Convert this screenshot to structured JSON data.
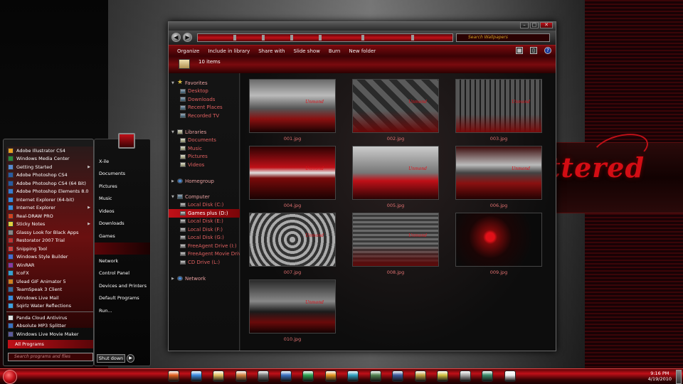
{
  "explorer": {
    "search_placeholder": "Search Wallpapers",
    "toolbar": [
      "Organize",
      "Include in library",
      "Share with",
      "Slide show",
      "Burn",
      "New folder"
    ],
    "item_count": "10 items",
    "nav": {
      "favorites": {
        "label": "Favorites",
        "items": [
          "Desktop",
          "Downloads",
          "Recent Places",
          "Recorded TV"
        ]
      },
      "libraries": {
        "label": "Libraries",
        "items": [
          "Documents",
          "Music",
          "Pictures",
          "Videos"
        ]
      },
      "homegroup": "Homegroup",
      "computer": {
        "label": "Computer",
        "items": [
          "Local Disk (C:)",
          "Games plus (D:)",
          "Local Disk (E:)",
          "Local Disk (F:)",
          "Local Disk (G:)",
          "FreeAgent Drive (I:)",
          "FreeAgent Movie Drive (",
          "CD Drive (L:)"
        ],
        "selected_index": 1
      },
      "network": "Network"
    },
    "files": [
      "001.jpg",
      "002.jpg",
      "003.jpg",
      "004.jpg",
      "005.jpg",
      "006.jpg",
      "007.jpg",
      "008.jpg",
      "009.jpg",
      "010.jpg"
    ],
    "watermark": "Unmond"
  },
  "start_menu": {
    "programs": [
      {
        "label": "Adobe Illustrator CS4",
        "color": "#e8a020"
      },
      {
        "label": "Windows Media Center",
        "color": "#2a8a3a"
      },
      {
        "label": "Getting Started",
        "color": "#5a8ad0",
        "submenu": true
      },
      {
        "label": "Adobe Photoshop CS4",
        "color": "#2a5aa0"
      },
      {
        "label": "Adobe Photoshop CS4 (64 Bit)",
        "color": "#2a5aa0"
      },
      {
        "label": "Adobe Photoshop Elements 8.0",
        "color": "#3a7ad0"
      },
      {
        "label": "Internet Explorer (64-bit)",
        "color": "#3a8ae0"
      },
      {
        "label": "Internet Explorer",
        "color": "#3a8ae0",
        "submenu": true
      },
      {
        "label": "Real-DRAW PRO",
        "color": "#d04020"
      },
      {
        "label": "Sticky Notes",
        "color": "#e0d040",
        "submenu": true
      },
      {
        "label": "Glassy Look for Black Apps",
        "color": "#888888"
      },
      {
        "label": "Restorator 2007 Trial",
        "color": "#c03030"
      },
      {
        "label": "Snipping Tool",
        "color": "#d04040"
      },
      {
        "label": "Windows Style Builder",
        "color": "#4a6ad0"
      },
      {
        "label": "WinRAR",
        "color": "#8a3aa0"
      },
      {
        "label": "IcoFX",
        "color": "#3aa0d0"
      },
      {
        "label": "Ulead GIF Animator 5",
        "color": "#d08020"
      },
      {
        "label": "TeamSpeak 3 Client",
        "color": "#3a6aa0"
      },
      {
        "label": "Windows Live Mail",
        "color": "#3a8ae0"
      },
      {
        "label": "Sqirlz Water Reflections",
        "color": "#40a0e0"
      },
      {
        "label": "Panda Cloud Antivirus",
        "color": "#e0e0e0"
      },
      {
        "label": "Absolute MP3 Splitter",
        "color": "#3a70c0"
      },
      {
        "label": "Windows Live Movie Maker",
        "color": "#5a5a9a"
      }
    ],
    "all_programs": "All Programs",
    "search_placeholder": "Search programs and files",
    "links": [
      "X-ile",
      "Documents",
      "Pictures",
      "Music",
      "Videos",
      "Downloads",
      "Games",
      "",
      "Network",
      "Control Panel",
      "Devices and Printers",
      "Default Programs",
      "Run..."
    ],
    "highlight_index": 7,
    "shutdown": "Shut down"
  },
  "taskbar": {
    "apps": [
      {
        "name": "firefox-icon",
        "color": "#e06020"
      },
      {
        "name": "internet-explorer-icon",
        "color": "#3a8ae0"
      },
      {
        "name": "explorer-icon",
        "color": "#e0c060"
      },
      {
        "name": "media-player-icon",
        "color": "#d08040"
      },
      {
        "name": "app-icon",
        "color": "#777777"
      },
      {
        "name": "photoshop-elements-icon",
        "color": "#3a70c0"
      },
      {
        "name": "app-icon",
        "color": "#2aa050"
      },
      {
        "name": "app-icon",
        "color": "#e09020"
      },
      {
        "name": "app-icon",
        "color": "#30a0c0"
      },
      {
        "name": "app-icon",
        "color": "#508050"
      },
      {
        "name": "app-icon",
        "color": "#3a5a9a"
      },
      {
        "name": "app-icon",
        "color": "#c0a040"
      },
      {
        "name": "app-icon",
        "color": "#d0c040"
      },
      {
        "name": "app-icon",
        "color": "#aaaaaa"
      },
      {
        "name": "app-icon",
        "color": "#3a8a6a"
      },
      {
        "name": "app-icon",
        "color": "#eeeeee"
      }
    ],
    "time": "9:16 PM",
    "date": "4/19/2010"
  },
  "wallpaper_text": "ttered"
}
